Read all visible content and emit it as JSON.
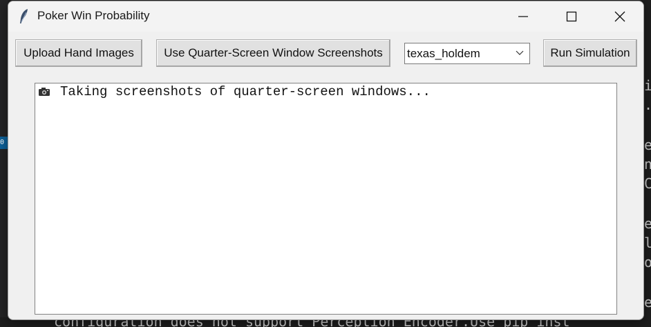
{
  "window": {
    "title": "Poker Win Probability",
    "icon": "feather-icon"
  },
  "toolbar": {
    "upload_label": "Upload Hand Images",
    "quarter_label": "Use Quarter-Screen Window Screenshots",
    "game_select_value": "texas_holdem",
    "run_label": "Run Simulation"
  },
  "log": {
    "lines": [
      {
        "icon": "camera-icon",
        "text": "Taking screenshots of quarter-screen windows..."
      }
    ]
  },
  "background": {
    "terminal_text": "configuration does not support Perception Encoder.Use pip inst",
    "badge_text": "0"
  }
}
